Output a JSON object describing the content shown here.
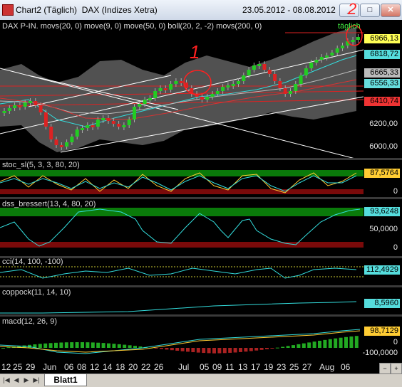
{
  "window": {
    "title": "Chart2 (Täglich)  DAX (Indizes Xetra)",
    "date_range": "23.05.2012 - 08.08.2012",
    "minimize_label": "_",
    "maximize_label": "□",
    "close_label": "✕"
  },
  "price_panel": {
    "label": "DAX P-IN. movs(20, 0) move(9, 0) move(50, 0) boll(20, 2, -2) movs(200, 0)",
    "period_tag": "täglich",
    "annotation_1": "1",
    "annotation_2": "2",
    "ticks": [
      "6200,00",
      "6000,00"
    ],
    "last_values": {
      "close": "6966,13",
      "upper_band": "6818,72",
      "ma_a": "6665,33",
      "ma_b": "6556,33",
      "ma200": "6410,74"
    },
    "colors": {
      "close": "#ffff55",
      "upper_band": "#55dddd",
      "ma_a": "#bbbbbb",
      "ma_b": "#66dddd",
      "ma200": "#ee3333"
    }
  },
  "stoc_panel": {
    "label": "stoc_sl(5, 3, 3, 80, 20)",
    "last_value": "87,5764",
    "tick": "0"
  },
  "dss_panel": {
    "label": "dss_bressert(13, 4, 80, 20)",
    "last_value": "93,6248",
    "ticks": [
      "50,0000",
      "0"
    ]
  },
  "cci_panel": {
    "label": "cci(14, 100, -100)",
    "last_value": "112,4929"
  },
  "coppock_panel": {
    "label": "coppock(11, 14, 10)",
    "last_value": "8,5960"
  },
  "macd_panel": {
    "label": "macd(12, 26, 9)",
    "last_value": "98,7129",
    "ticks": [
      "0",
      "-100,0000"
    ]
  },
  "x_axis": {
    "labels": [
      "12",
      "25",
      "29",
      "Jun",
      "06",
      "08",
      "12",
      "14",
      "18",
      "20",
      "22",
      "26",
      "Jul",
      "05",
      "09",
      "11",
      "13",
      "17",
      "19",
      "23",
      "25",
      "27",
      "Aug",
      "06"
    ]
  },
  "sheet_tabs": {
    "active": "Blatt1"
  }
}
